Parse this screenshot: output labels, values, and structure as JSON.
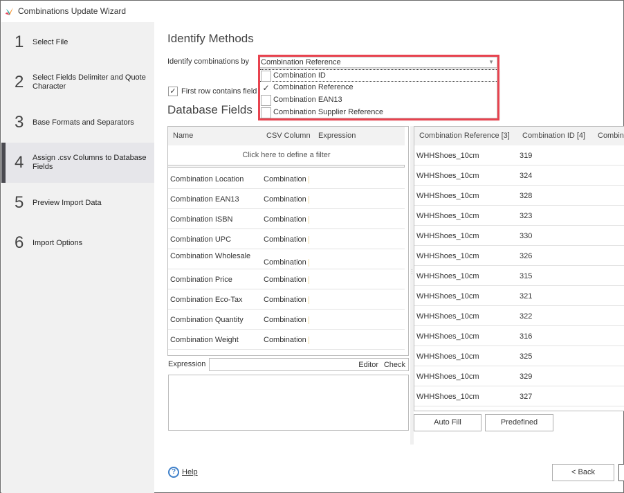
{
  "window": {
    "title": "Combinations Update Wizard",
    "logo_icon": "app-logo-icon"
  },
  "sidebar": {
    "steps": [
      {
        "number": "1",
        "label": "Select File",
        "active": false
      },
      {
        "number": "2",
        "label": "Select Fields Delimiter and Quote Character",
        "active": false
      },
      {
        "number": "3",
        "label": "Base Formats and Separators",
        "active": false
      },
      {
        "number": "4",
        "label": "Assign .csv Columns to Database Fields",
        "active": true
      },
      {
        "number": "5",
        "label": "Preview Import Data",
        "active": false
      },
      {
        "number": "6",
        "label": "Import Options",
        "active": false
      }
    ]
  },
  "identify": {
    "heading": "Identify Methods",
    "label": "Identify combinations by",
    "selected": "Combination Reference",
    "options": [
      {
        "label": "Combination ID",
        "checked": false
      },
      {
        "label": "Combination Reference",
        "checked": true
      },
      {
        "label": "Combination EAN13",
        "checked": false
      },
      {
        "label": "Combination Supplier Reference",
        "checked": false
      }
    ],
    "highlight_color": "#e8434f"
  },
  "first_row": {
    "label": "First row contains field",
    "checked": true
  },
  "database_fields": {
    "heading": "Database Fields",
    "columns": [
      "Name",
      "CSV Column",
      "Expression"
    ],
    "filter_text": "Click here to define a filter",
    "rows": [
      {
        "name": "Combination Location",
        "csv": "Combination"
      },
      {
        "name": "Combination EAN13",
        "csv": "Combination"
      },
      {
        "name": "Combination ISBN",
        "csv": "Combination"
      },
      {
        "name": "Combination UPC",
        "csv": "Combination"
      },
      {
        "name": "Combination Wholesale",
        "csv": "Combination"
      },
      {
        "name": "Combination Price",
        "csv": "Combination"
      },
      {
        "name": "Combination Eco-Tax",
        "csv": "Combination"
      },
      {
        "name": "Combination Quantity",
        "csv": "Combination"
      },
      {
        "name": "Combination Weight",
        "csv": "Combination"
      }
    ]
  },
  "expression": {
    "label": "Expression",
    "editor_label": "Editor",
    "check_label": "Check",
    "value": ""
  },
  "preview": {
    "columns": [
      "Combination Reference [3]",
      "Combination ID [4]",
      "Combin"
    ],
    "rows": [
      {
        "ref": "WHHShoes_10cm",
        "id": "319"
      },
      {
        "ref": "WHHShoes_10cm",
        "id": "324"
      },
      {
        "ref": "WHHShoes_10cm",
        "id": "328"
      },
      {
        "ref": "WHHShoes_10cm",
        "id": "323"
      },
      {
        "ref": "WHHShoes_10cm",
        "id": "330"
      },
      {
        "ref": "WHHShoes_10cm",
        "id": "326"
      },
      {
        "ref": "WHHShoes_10cm",
        "id": "315"
      },
      {
        "ref": "WHHShoes_10cm",
        "id": "321"
      },
      {
        "ref": "WHHShoes_10cm",
        "id": "322"
      },
      {
        "ref": "WHHShoes_10cm",
        "id": "316"
      },
      {
        "ref": "WHHShoes_10cm",
        "id": "325"
      },
      {
        "ref": "WHHShoes_10cm",
        "id": "329"
      },
      {
        "ref": "WHHShoes_10cm",
        "id": "327"
      }
    ],
    "auto_fill_label": "Auto Fill",
    "predefined_label": "Predefined"
  },
  "footer": {
    "help_label": "Help",
    "back_label": "< Back"
  }
}
